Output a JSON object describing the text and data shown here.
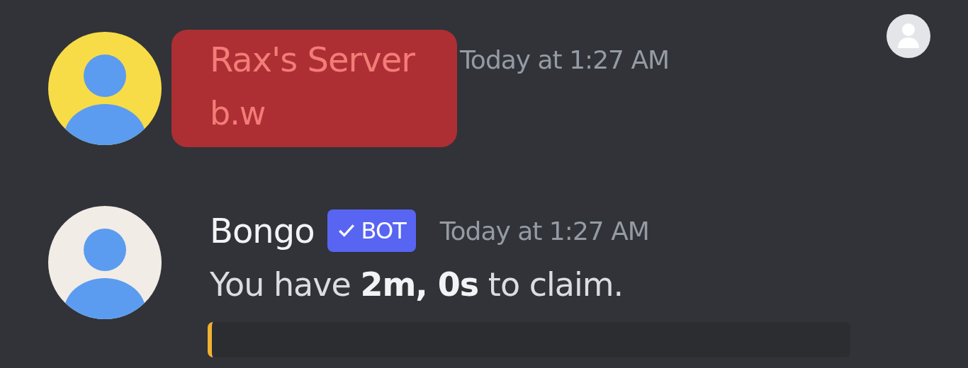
{
  "messages": [
    {
      "author": "Rax's Server",
      "timestamp": "Today at 1:27 AM",
      "content": "b.w",
      "highlighted": true,
      "color": "#f7dc48"
    },
    {
      "author": "Bongo",
      "badge": "BOT",
      "verified": true,
      "timestamp": "Today at 1:27 AM",
      "content": "You have **2m, 0s** to claim.",
      "highlighted": false,
      "color": "#f2ece6",
      "embed": {
        "color": "#f0b232"
      }
    }
  ]
}
